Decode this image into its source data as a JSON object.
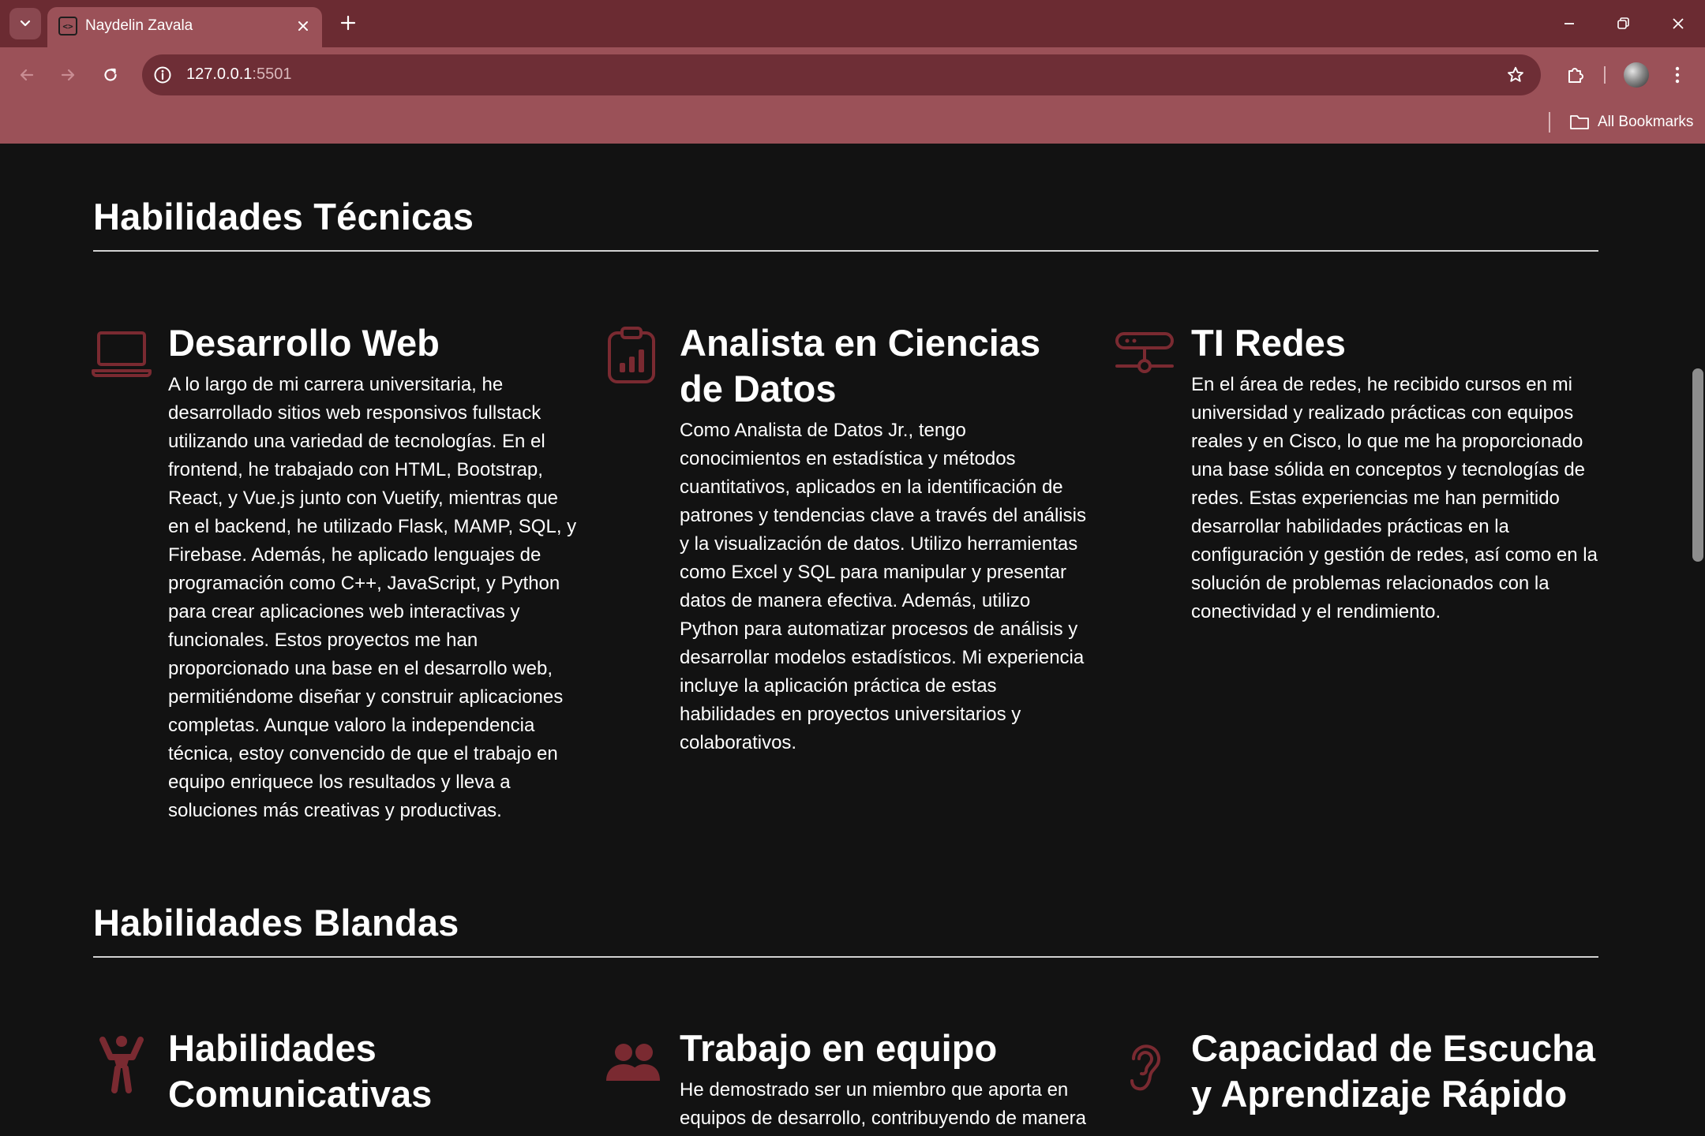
{
  "browser": {
    "tab_title": "Naydelin Zavala",
    "url_host": "127.0.0.1",
    "url_port": ":5501",
    "bookmarks_label": "All Bookmarks"
  },
  "sections": {
    "technical": {
      "title": "Habilidades Técnicas",
      "cards": [
        {
          "icon": "laptop-icon",
          "title": "Desarrollo Web",
          "text": "A lo largo de mi carrera universitaria, he desarrollado sitios web responsivos fullstack utilizando una variedad de tecnologías. En el frontend, he trabajado con HTML, Bootstrap, React, y Vue.js junto con Vuetify, mientras que en el backend, he utilizado Flask, MAMP, SQL, y Firebase. Además, he aplicado lenguajes de programación como C++, JavaScript, y Python para crear aplicaciones web interactivas y funcionales. Estos proyectos me han proporcionado una base en el desarrollo web, permitiéndome diseñar y construir aplicaciones completas. Aunque valoro la independencia técnica, estoy convencido de que el trabajo en equipo enriquece los resultados y lleva a soluciones más creativas y productivas."
        },
        {
          "icon": "clipboard-chart-icon",
          "title": "Analista en Ciencias de Datos",
          "text": "Como Analista de Datos Jr., tengo conocimientos en estadística y métodos cuantitativos, aplicados en la identificación de patrones y tendencias clave a través del análisis y la visualización de datos. Utilizo herramientas como Excel y SQL para manipular y presentar datos de manera efectiva. Además, utilizo Python para automatizar procesos de análisis y desarrollar modelos estadísticos. Mi experiencia incluye la aplicación práctica de estas habilidades en proyectos universitarios y colaborativos."
        },
        {
          "icon": "network-icon",
          "title": "TI Redes",
          "text": "En el área de redes, he recibido cursos en mi universidad y realizado prácticas con equipos reales y en Cisco, lo que me ha proporcionado una base sólida en conceptos y tecnologías de redes. Estas experiencias me han permitido desarrollar habilidades prácticas en la configuración y gestión de redes, así como en la solución de problemas relacionados con la conectividad y el rendimiento."
        }
      ]
    },
    "soft": {
      "title": "Habilidades Blandas",
      "cards": [
        {
          "icon": "person-arms-up-icon",
          "title": "Habilidades Comunicativas",
          "text": ""
        },
        {
          "icon": "people-icon",
          "title": "Trabajo en equipo",
          "text": "He demostrado ser un miembro que aporta en equipos de desarrollo, contribuyendo de manera"
        },
        {
          "icon": "ear-icon",
          "title": "Capacidad de Escucha y Aprendizaje Rápido",
          "text": ""
        }
      ]
    }
  },
  "colors": {
    "accent": "#7a2a31",
    "titlebar": "#6b2b32",
    "toolbar": "#9b5158",
    "page_bg": "#121212"
  }
}
